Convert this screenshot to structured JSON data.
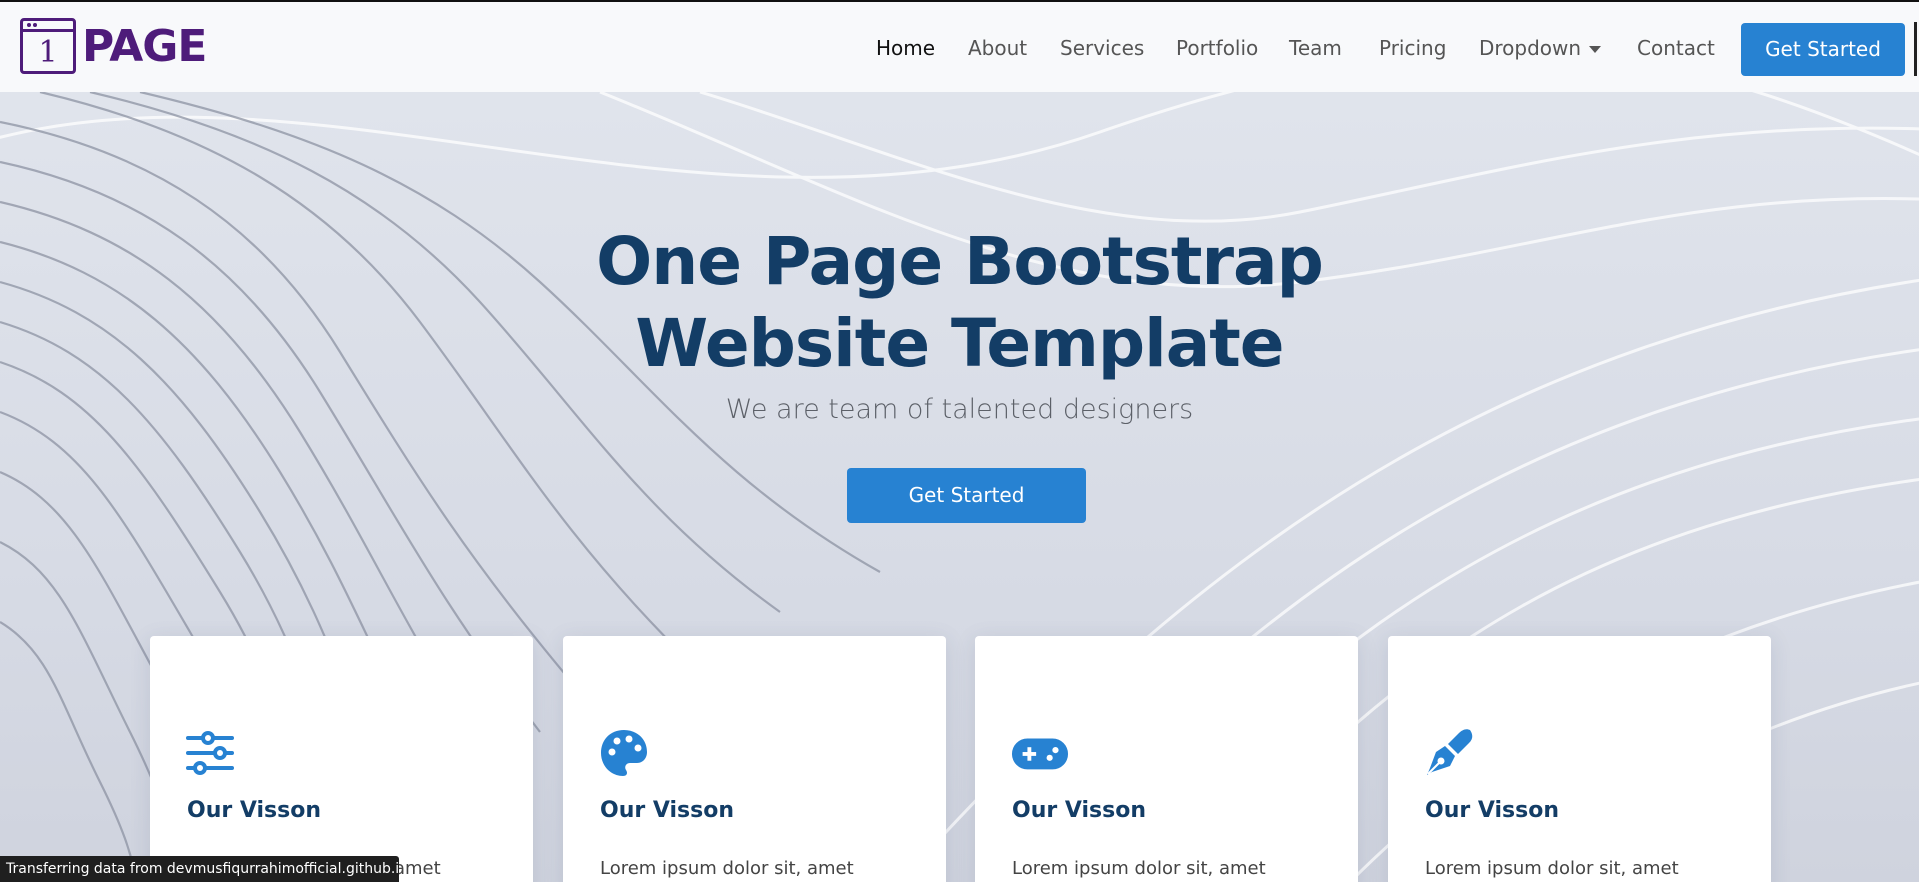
{
  "brand": {
    "logo_glyph": "1",
    "name": "PAGE",
    "color": "#4e1c7a"
  },
  "nav": {
    "items": [
      {
        "label": "Home",
        "active": true
      },
      {
        "label": "About"
      },
      {
        "label": "Services"
      },
      {
        "label": "Portfolio"
      },
      {
        "label": "Team"
      },
      {
        "label": "Pricing"
      },
      {
        "label": "Dropdown",
        "has_caret": true
      },
      {
        "label": "Contact"
      }
    ],
    "cta_label": "Get Started"
  },
  "hero": {
    "title_line1": "One Page Bootstrap",
    "title_line2": "Website Template",
    "subtitle": "We are team of talented designers",
    "cta_label": "Get Started"
  },
  "cards": [
    {
      "icon": "sliders-icon",
      "title": "Our Visson",
      "text": "Lorem ipsum dolor sit, amet"
    },
    {
      "icon": "palette-icon",
      "title": "Our Visson",
      "text": "Lorem ipsum dolor sit, amet"
    },
    {
      "icon": "gamepad-icon",
      "title": "Our Visson",
      "text": "Lorem ipsum dolor sit, amet"
    },
    {
      "icon": "pen-nib-icon",
      "title": "Our Visson",
      "text": "Lorem ipsum dolor sit, amet"
    }
  ],
  "status_bar": "Transferring data from devmusfiqurrahimofficial.github.io...",
  "colors": {
    "accent": "#2782d2",
    "heading": "#133d66"
  }
}
